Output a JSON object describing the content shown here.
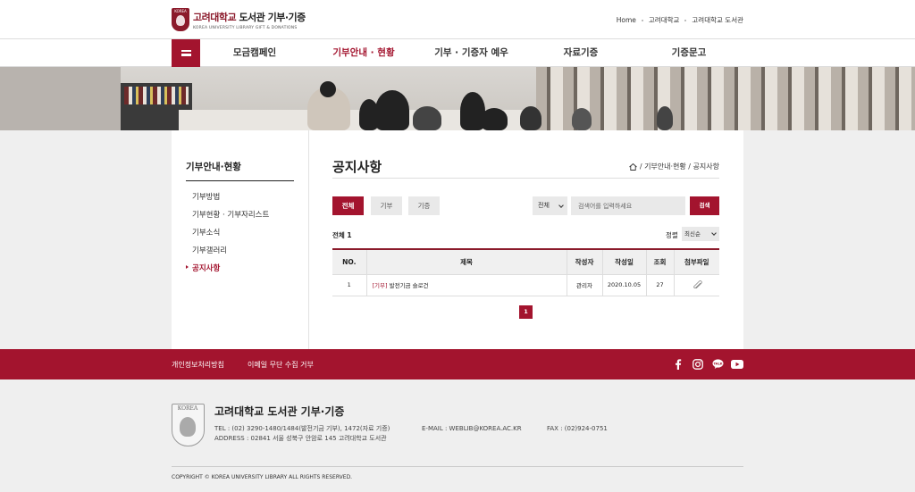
{
  "header": {
    "logo_title_red": "고려대학교",
    "logo_title_rest": " 도서관 기부·기증",
    "logo_sub": "KOREA UNIVERSITY LIBRARY GIFT & DONATIONS",
    "links": [
      "Home",
      "고려대학교",
      "고려대학교 도서관"
    ]
  },
  "nav": {
    "items": [
      "모금캠페인",
      "기부안내 · 현황",
      "기부 · 기증자 예우",
      "자료기증",
      "기증문고"
    ],
    "active_index": 1
  },
  "sidebar": {
    "title": "기부안내·현황",
    "items": [
      "기부방법",
      "기부현황 · 기부자리스트",
      "기부소식",
      "기부갤러리",
      "공지사항"
    ],
    "active_index": 4
  },
  "main": {
    "title": "공지사항",
    "breadcrumb": "/ 기부안내·현황 / 공지사항",
    "tabs": [
      "전체",
      "기부",
      "기증"
    ],
    "search_scope": "전체",
    "search_placeholder": "검색어를 입력하세요",
    "search_button": "검색",
    "total_label": "전체 1",
    "sort_label": "정렬",
    "sort_value": "최신순",
    "columns": [
      "NO.",
      "제목",
      "작성자",
      "작성일",
      "조회",
      "첨부파일"
    ],
    "rows": [
      {
        "no": "1",
        "category": "[기부]",
        "title": " 발전기금 슬로건",
        "author": "관리자",
        "date": "2020.10.05",
        "views": "27"
      }
    ],
    "page": "1"
  },
  "footbar": {
    "links": [
      "개인정보처리방침",
      "이메일 무단 수집 거부"
    ],
    "social": [
      "facebook-icon",
      "instagram-icon",
      "kakaotalk-icon",
      "youtube-icon"
    ]
  },
  "footer": {
    "title": "고려대학교 도서관 기부·기증",
    "tel": "TEL : (02) 3290-1480/1484(발전기금 기부), 1472(자료 기증)",
    "address": "ADDRESS : 02841 서울 성북구 안암로 145 고려대학교 도서관",
    "email": "E-MAIL : WEBLIB@KOREA.AC.KR",
    "fax": "FAX : (02)924-0751",
    "copyright": "COPYRIGHT © KOREA UNIVERSITY LIBRARY ALL RIGHTS RESERVED."
  },
  "colors": {
    "brand": "#a3142e",
    "bg": "#efefef"
  }
}
